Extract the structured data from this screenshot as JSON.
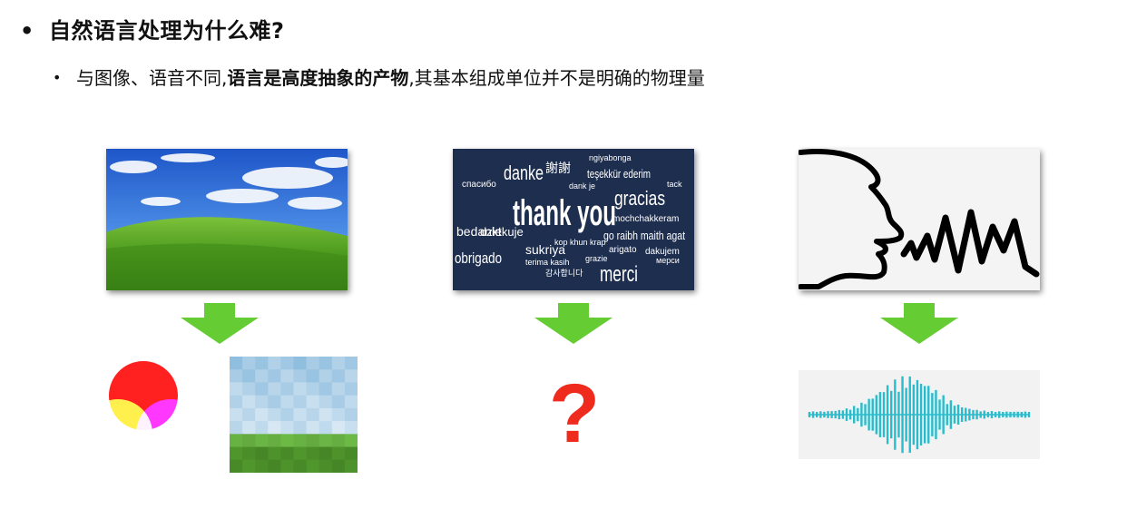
{
  "bullets": {
    "level1": {
      "marker": "•",
      "text": "自然语言处理为什么难?"
    },
    "level2": {
      "marker": "•",
      "prefix": "与图像、语音不同,",
      "emphasis": "语言是高度抽象的产物",
      "suffix": ",其基本组成单位并不是明确的物理量"
    }
  },
  "columns": {
    "image": {
      "source_icon": "landscape-photo-icon",
      "result_icons": [
        "rgb-color-circles-icon",
        "pixelated-landscape-icon"
      ]
    },
    "language": {
      "source_icon": "thank-you-word-cloud-icon",
      "result_symbol": "?",
      "word_cloud_words": [
        "thank you",
        "danke",
        "謝謝",
        "gracias",
        "merci",
        "obrigado",
        "teşekkür ederim",
        "ngiyabonga",
        "спасибо",
        "bedankt",
        "dziekuje",
        "sukriya",
        "go raibh maith agat",
        "mochchakkeram",
        "dakujem",
        "terima kasih",
        "kop khun krap",
        "arigato",
        "감사합니다",
        "мерси",
        "grazie",
        "dank je",
        "tack"
      ]
    },
    "speech": {
      "source_icon": "speaking-face-icon",
      "result_icon": "sound-waveform-icon"
    }
  },
  "colors": {
    "arrow": "#66cc33",
    "question_mark": "#ef2b1e",
    "waveform": "#29bccc",
    "word_cloud_bg": "#1e2e4e",
    "rgb_red": "#ff2020",
    "rgb_green": "#33ee33",
    "rgb_blue": "#1a1aff"
  }
}
